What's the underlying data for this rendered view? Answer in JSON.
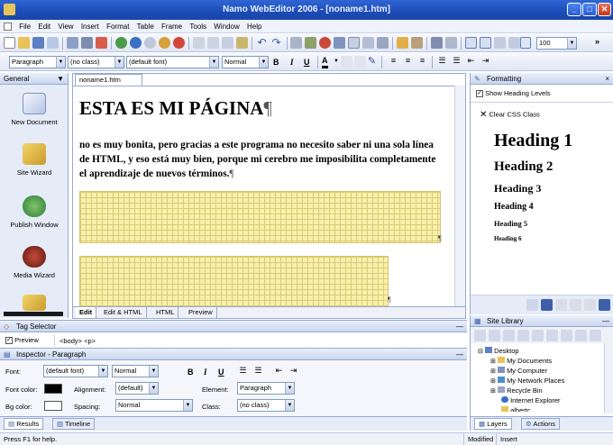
{
  "window": {
    "title": "Namo WebEditor 2006 - [noname1.htm]"
  },
  "menu": [
    "File",
    "Edit",
    "View",
    "Insert",
    "Format",
    "Table",
    "Frame",
    "Tools",
    "Window",
    "Help"
  ],
  "toolbar": {
    "zoom": "100"
  },
  "format_bar": {
    "paragraph": "Paragraph",
    "class": "(no class)",
    "font": "(default font)",
    "size": "Normal",
    "bold": "B",
    "italic": "I",
    "underline": "U",
    "font_color": "A"
  },
  "sidebar": {
    "title": "General",
    "items": [
      "New Document",
      "Site Wizard",
      "Publish Window",
      "Media Wizard"
    ]
  },
  "doc": {
    "tab": "noname1.htm",
    "heading": "ESTA ES MI PÁGINA",
    "pilcrow": "¶",
    "paragraph": "no es muy bonita, pero gracias a este programa no necesito saber ni una sola línea de HTML, y eso está muy bien, porque mi cerebro me imposibilita completamente el aprendizaje de nuevos términos.",
    "tabs": [
      "Edit",
      "Edit & HTML",
      "HTML",
      "Preview"
    ]
  },
  "formatting": {
    "title": "Formatting",
    "show_heading": "Show Heading Levels",
    "clear_css": "Clear CSS Class",
    "headings": [
      "Heading 1",
      "Heading 2",
      "Heading 3",
      "Heading 4",
      "Heading 5",
      "Heading 6"
    ]
  },
  "tag_selector": {
    "title": "Tag Selector",
    "preview_label": "Preview",
    "tags": "<body> <p>"
  },
  "inspector": {
    "title": "Inspector - Paragraph",
    "font_label": "Font:",
    "font_value": "(default font)",
    "size_value": "Normal",
    "font_color_label": "Font color:",
    "alignment_label": "Alignment:",
    "alignment_value": "(default)",
    "element_label": "Element:",
    "element_value": "Paragraph",
    "bg_color_label": "Bg color:",
    "spacing_label": "Spacing:",
    "spacing_value": "Normal",
    "class_label": "Class:",
    "class_value": "(no class)",
    "bold": "B",
    "italic": "I",
    "underline": "U"
  },
  "bottom_tabs": [
    "Results",
    "Timeline"
  ],
  "site_library": {
    "title": "Site Library",
    "items": [
      "Desktop",
      "My Documents",
      "My Computer",
      "My Network Places",
      "Recycle Bin",
      "Internet Explorer",
      "albertc"
    ],
    "tabs": [
      "Layers",
      "Actions"
    ]
  },
  "status": {
    "help": "Press F1 for help.",
    "modified": "Modified",
    "mode": "Insert"
  },
  "colors": {
    "accent": "#2f66d4",
    "grid_yellow": "#f9efad"
  }
}
